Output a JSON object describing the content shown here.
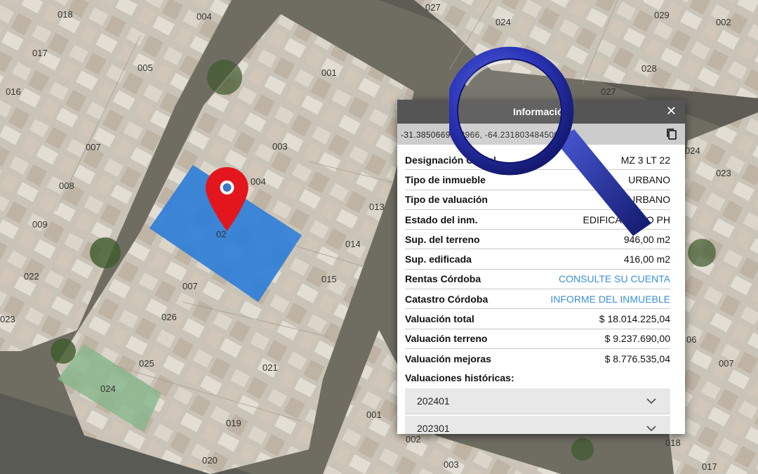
{
  "map": {
    "lot_labels": [
      "018",
      "004",
      "017",
      "005",
      "001",
      "016",
      "007",
      "003",
      "008",
      "004",
      "009",
      "013",
      "014",
      "022",
      "007",
      "015",
      "023",
      "026",
      "025",
      "021",
      "024",
      "019",
      "020",
      "001",
      "027",
      "024",
      "029",
      "002",
      "028",
      "027",
      "024",
      "023",
      "06",
      "007",
      "018",
      "017",
      "002",
      "003"
    ],
    "selected_lot_label": "02",
    "selected_color": "#2f7ed8"
  },
  "panel": {
    "title": "Información",
    "coordinates": "-31.3850669463966, -64.2318034845004",
    "rows": [
      {
        "label": "Designación Oficial",
        "value": "MZ 3 LT 22",
        "link": false
      },
      {
        "label": "Tipo de inmueble",
        "value": "URBANO",
        "link": false
      },
      {
        "label": "Tipo de valuación",
        "value": "URBANO",
        "link": false
      },
      {
        "label": "Estado del inm.",
        "value": "EDIFICADO NO PH",
        "link": false
      },
      {
        "label": "Sup. del terreno",
        "value": "946,00 m2",
        "link": false
      },
      {
        "label": "Sup. edificada",
        "value": "416,00 m2",
        "link": false
      },
      {
        "label": "Rentas Córdoba",
        "value": "CONSULTE SU CUENTA",
        "link": true
      },
      {
        "label": "Catastro Córdoba",
        "value": "INFORME DEL INMUEBLE",
        "link": true
      },
      {
        "label": "Valuación total",
        "value": "$ 18.014.225,04",
        "link": false
      },
      {
        "label": "Valuación terreno",
        "value": "$ 9.237.690,00",
        "link": false
      },
      {
        "label": "Valuación mejoras",
        "value": "$ 8.776.535,04",
        "link": false
      }
    ],
    "historic_title": "Valuaciones históricas:",
    "historic_items": [
      "202401",
      "202301"
    ],
    "link_color": "#3a8fd6"
  },
  "icons": {
    "close": "close-icon",
    "copy": "copy-icon",
    "pin": "map-pin-icon",
    "magnifier": "magnifying-glass-icon",
    "chevron": "chevron-down-icon"
  }
}
